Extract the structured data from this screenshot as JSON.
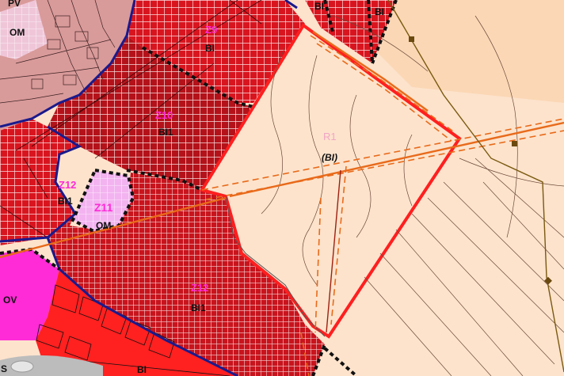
{
  "labels": {
    "pv": "PV",
    "om_top": "OM",
    "bi_top1": "BI",
    "bi_top2": "BI",
    "z9": "Z9",
    "z9_sub": "BI",
    "z10": "Z10",
    "z10_sub": "BI1",
    "r1": "R1",
    "r1_sub": "(BI)",
    "z12_left": "Z12",
    "z12_left_sub": "BI1",
    "z11": "Z11",
    "z11_sub": "OM",
    "z12_main": "Z12",
    "z12_main_sub": "BI1",
    "ov": "OV",
    "bi_bottom": "BI",
    "s_edge": "S"
  },
  "colors": {
    "background_peach": "#fde3cc",
    "red_hatch_zone": "#d8151f",
    "dark_red_zone": "#b4121a",
    "pink_residential": "#d99a9a",
    "light_pink_zone": "#f3b3f0",
    "magenta_zone": "#ff2bd6",
    "bright_red_zone": "#ff2020",
    "blue_boundary": "#1a1a8c",
    "highlight_red": "#ff1f1f",
    "orange_line": "#e86a1a",
    "label_magenta": "#ff2bd6"
  }
}
